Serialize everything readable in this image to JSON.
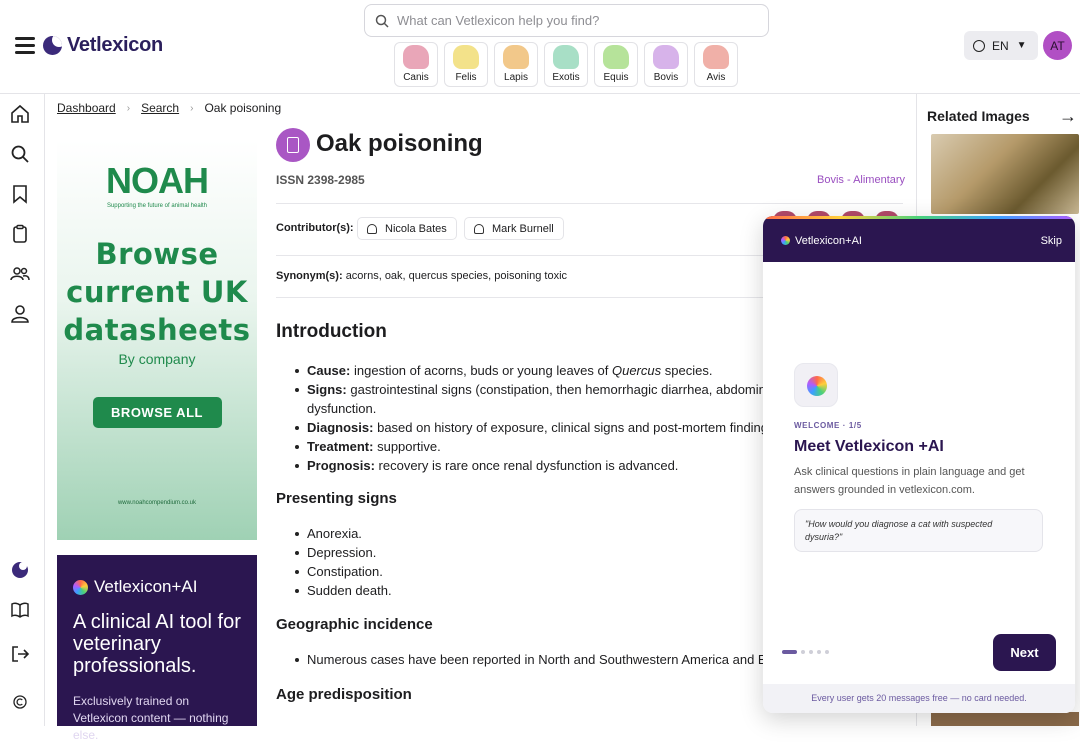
{
  "header": {
    "app_name": "Vetlexicon",
    "search_placeholder": "What can Vetlexicon help you find?",
    "species": [
      {
        "label": "Canis",
        "color": "#e9a6b8"
      },
      {
        "label": "Felis",
        "color": "#f3e28a"
      },
      {
        "label": "Lapis",
        "color": "#f2c88a"
      },
      {
        "label": "Exotis",
        "color": "#a8dfc6"
      },
      {
        "label": "Equis",
        "color": "#b6e39a"
      },
      {
        "label": "Bovis",
        "color": "#d7b3ea"
      },
      {
        "label": "Avis",
        "color": "#f0b0a8"
      }
    ],
    "language": "EN",
    "avatar_initials": "AT"
  },
  "breadcrumb": {
    "items": [
      "Dashboard",
      "Search"
    ],
    "current": "Oak poisoning"
  },
  "article": {
    "title": "Oak poisoning",
    "issn": "ISSN 2398-2985",
    "category": "Bovis - Alimentary",
    "contributors_label": "Contributor(s):",
    "contributors": [
      "Nicola Bates",
      "Mark Burnell"
    ],
    "synonyms_label": "Synonym(s):",
    "synonyms": "acorns, oak, quercus species, poisoning toxic",
    "intro_heading": "Introduction",
    "intro": [
      {
        "label": "Cause:",
        "text": "ingestion of acorns, buds or young leaves of ",
        "italic": "Quercus",
        "after": " species."
      },
      {
        "label": "Signs:",
        "text": "gastrointestinal signs (constipation, then hemorrhagic diarrhea, abdomina"
      },
      {
        "label": "",
        "text": "dysfunction."
      },
      {
        "label": "Diagnosis:",
        "text": "based on history of exposure, clinical signs and post-mortem findings"
      },
      {
        "label": "Treatment:",
        "text": "supportive."
      },
      {
        "label": "Prognosis:",
        "text": "recovery is rare once renal dysfunction is advanced."
      }
    ],
    "presenting_heading": "Presenting signs",
    "presenting": [
      "Anorexia.",
      "Depression.",
      "Constipation.",
      "Sudden death."
    ],
    "geo_heading": "Geographic incidence",
    "geo": [
      "Numerous cases have been reported in North and Southwestern America and Eur"
    ],
    "age_heading": "Age predisposition"
  },
  "ads": {
    "noah": {
      "logo": "NOAH",
      "tagline": "Supporting the future of animal health",
      "line1": "Browse",
      "line2": "current UK",
      "line3": "datasheets",
      "by": "By company",
      "button": "BROWSE ALL",
      "url": "www.noahcompendium.co.uk"
    },
    "ai": {
      "brand": "Vetlexicon+AI",
      "headline": "A clinical AI tool for veterinary professionals.",
      "sub": "Exclusively trained on Vetlexicon content — nothing else."
    }
  },
  "related": {
    "title": "Related Images"
  },
  "modal": {
    "brand": "Vetlexicon+AI",
    "skip": "Skip",
    "step": "WELCOME · 1/5",
    "heading": "Meet Vetlexicon +AI",
    "body": "Ask clinical questions in plain language and get answers grounded in vetlexicon.com.",
    "quote": "\"How would you diagnose a cat with suspected dysuria?\"",
    "next": "Next",
    "footer": "Every user gets 20 messages free — no card needed.",
    "progress": {
      "current": 1,
      "total": 5
    }
  },
  "colors": {
    "brand": "#2b1650",
    "accent": "#a957c4",
    "noah_green": "#1f8a4c"
  }
}
